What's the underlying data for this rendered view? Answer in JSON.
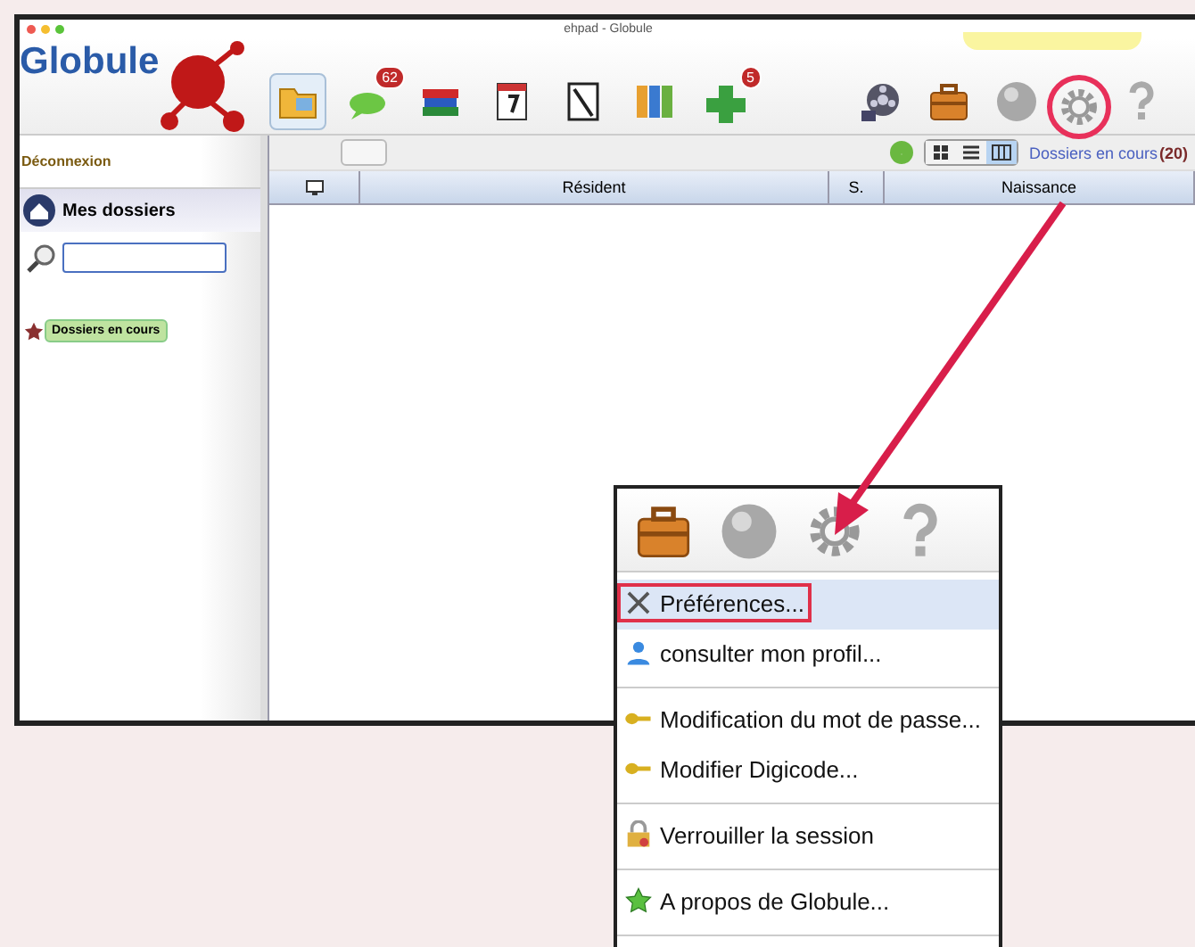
{
  "window": {
    "title": "ehpad - Globule"
  },
  "logo": {
    "text": "Globule"
  },
  "toolbar": [
    {
      "kind": "folder",
      "selected": true
    },
    {
      "kind": "chat",
      "selected": false,
      "badge": "62"
    },
    {
      "kind": "books",
      "selected": false
    },
    {
      "kind": "calendar",
      "selected": false
    },
    {
      "kind": "notepad",
      "selected": false
    },
    {
      "kind": "binders",
      "selected": false
    },
    {
      "kind": "cross",
      "selected": false,
      "badge": "5"
    }
  ],
  "toolbar_right": [
    {
      "kind": "film",
      "circled": false
    },
    {
      "kind": "briefcase",
      "circled": false
    },
    {
      "kind": "ball",
      "circled": false
    },
    {
      "kind": "gear",
      "circled": true
    },
    {
      "kind": "help",
      "circled": false
    }
  ],
  "sidebar": {
    "logout": "Déconnexion",
    "section": "Mes dossiers",
    "tag": "Dossiers en cours"
  },
  "main": {
    "view_modes": [
      {
        "kind": "grid",
        "selected": false
      },
      {
        "kind": "list",
        "selected": false
      },
      {
        "kind": "columns",
        "selected": true
      }
    ],
    "filter_link": "Dossiers en cours",
    "count": "(20)",
    "columns": [
      {
        "kind": "icon"
      },
      {
        "kind": "text",
        "label": "Résident"
      },
      {
        "kind": "text",
        "label": "S."
      },
      {
        "kind": "text",
        "label": "Naissance"
      }
    ]
  },
  "menu": {
    "icons": [
      {
        "kind": "briefcase"
      },
      {
        "kind": "ball"
      },
      {
        "kind": "gear"
      },
      {
        "kind": "help"
      }
    ],
    "groups": [
      [
        {
          "kind": "tools",
          "label": "Préférences...",
          "selected": true,
          "highlighted": true
        },
        {
          "kind": "user",
          "label": "consulter mon profil...",
          "selected": false,
          "highlighted": false
        }
      ],
      [
        {
          "kind": "key",
          "label": "Modification du mot de passe...",
          "selected": false,
          "highlighted": false
        },
        {
          "kind": "key",
          "label": "Modifier Digicode...",
          "selected": false,
          "highlighted": false
        }
      ],
      [
        {
          "kind": "lock",
          "label": "Verrouiller la session",
          "selected": false,
          "highlighted": false
        }
      ],
      [
        {
          "kind": "star",
          "label": "A propos de Globule...",
          "selected": false,
          "highlighted": false
        }
      ]
    ]
  }
}
